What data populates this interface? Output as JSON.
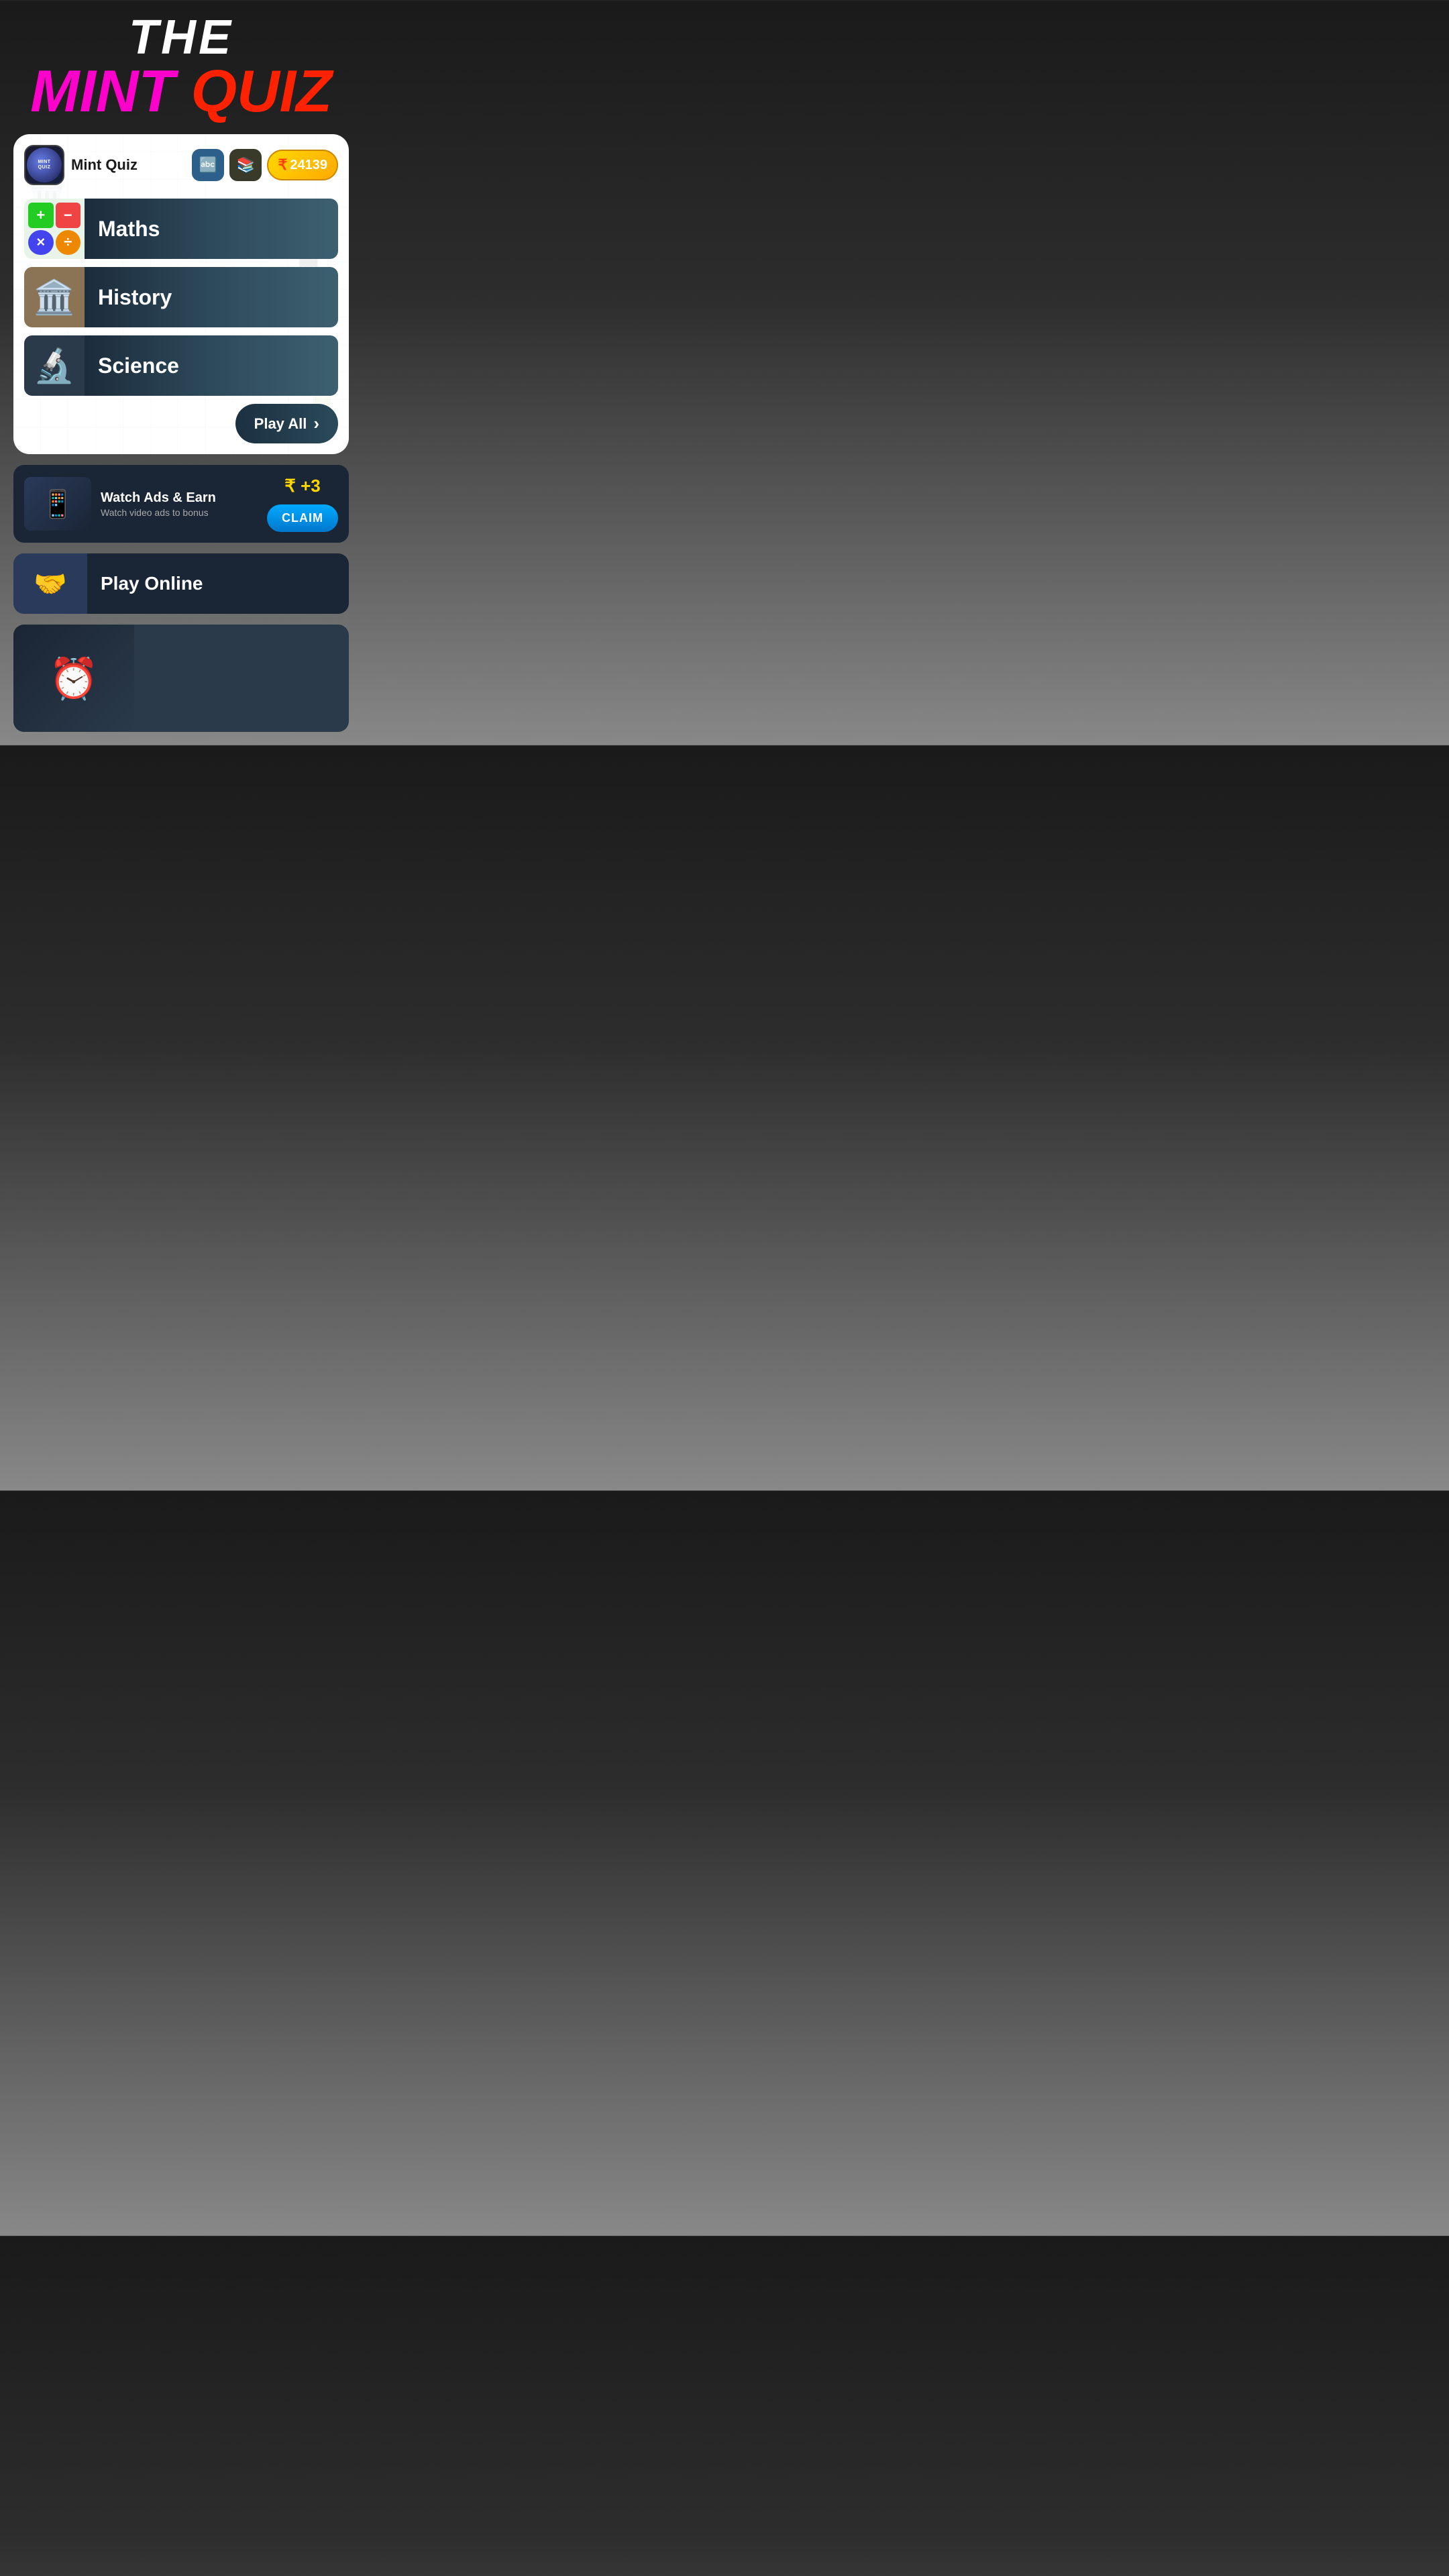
{
  "header": {
    "the_label": "THE",
    "mint_label": "MINT",
    "quiz_label": "QUIZ"
  },
  "topbar": {
    "app_name": "Mint Quiz",
    "translate_icon": "🔤",
    "books_icon": "📚",
    "coin_symbol": "₹",
    "coin_amount": "24139"
  },
  "categories": [
    {
      "id": "maths",
      "label": "Maths",
      "emoji": "maths"
    },
    {
      "id": "history",
      "label": "History",
      "emoji": "🏛️"
    },
    {
      "id": "science",
      "label": "Science",
      "emoji": "🔬"
    }
  ],
  "play_all": {
    "label": "Play All",
    "arrow": "›"
  },
  "ads_section": {
    "title": "Watch Ads & Earn",
    "subtitle": "Watch video ads to bonus",
    "reward": "+3",
    "claim_label": "CLAIM",
    "icon": "📱"
  },
  "play_online": {
    "label": "Play Online",
    "icon": "🤝"
  },
  "bottom_section": {
    "icon": "⏰"
  }
}
